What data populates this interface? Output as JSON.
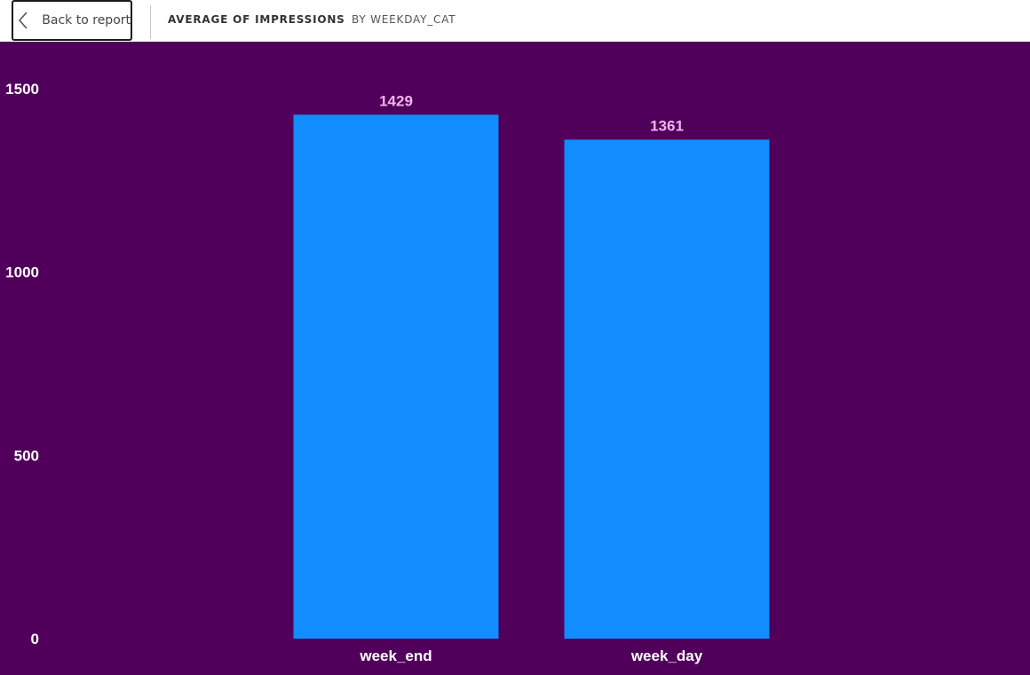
{
  "header": {
    "back_label": "Back to report",
    "back_icon": "chevron-left-icon",
    "title": "AVERAGE OF IMPRESSIONS",
    "subtitle": "BY WEEKDAY_CAT"
  },
  "colors": {
    "background": "#50005a",
    "bar": "#118dff",
    "data_label": "#f5b2f0",
    "axis_text": "#ffffff"
  },
  "chart_data": {
    "type": "bar",
    "title": "AVERAGE OF IMPRESSIONS",
    "subtitle": "BY WEEKDAY_CAT",
    "categories": [
      "week_end",
      "week_day"
    ],
    "values": [
      1429,
      1361
    ],
    "data_labels": [
      "1429",
      "1361"
    ],
    "y_ticks": [
      0,
      500,
      1000,
      1500
    ],
    "ylim": [
      0,
      1500
    ],
    "xlabel": "",
    "ylabel": "",
    "grid": false,
    "legend": "none"
  }
}
